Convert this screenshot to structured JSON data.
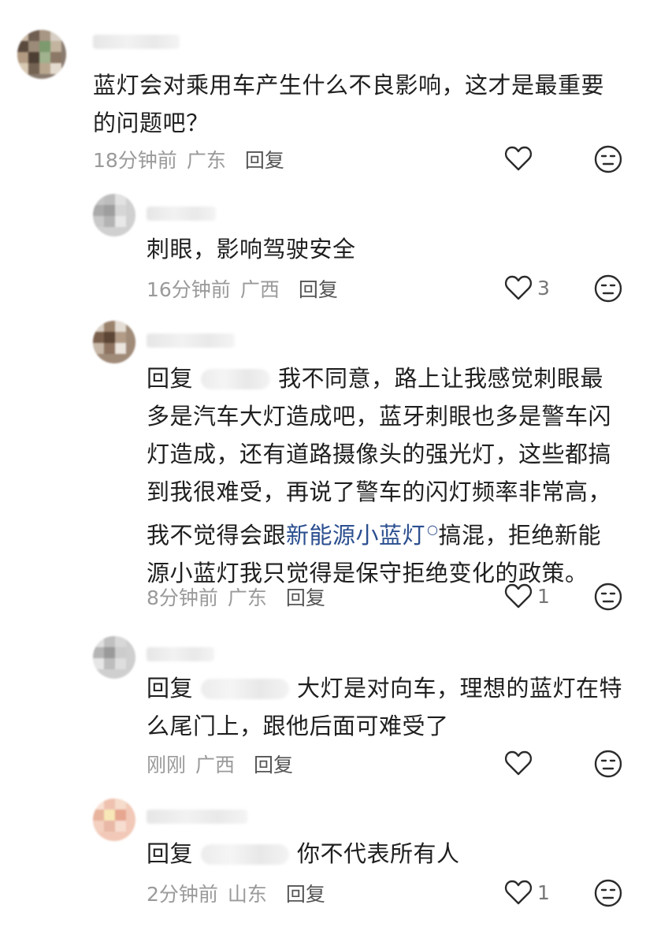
{
  "comments": [
    {
      "text": "蓝灯会对乘用车产生什么不良影响，这才是最重要的问题吧？",
      "time": "18分钟前",
      "region": "广东",
      "reply_label": "回复",
      "likes": ""
    },
    {
      "text": "刺眼，影响驾驶安全",
      "time": "16分钟前",
      "region": "广西",
      "reply_label": "回复",
      "likes": "3"
    },
    {
      "reply_prefix": "回复",
      "text_part1": "我不同意，路上让我感觉刺眼最多是汽车大灯造成吧，蓝牙刺眼也多是警车闪灯造成，还有道路摄像头的强光灯，这些都搞到我很难受，再说了警车的闪灯频率非常高，我不觉得会跟",
      "link_text": "新能源小蓝灯",
      "text_part2": "搞混，拒绝新能源小蓝灯我只觉得是保守拒绝变化的政策。",
      "time": "8分钟前",
      "region": "广东",
      "reply_label": "回复",
      "likes": "1"
    },
    {
      "reply_prefix": "回复",
      "text": "大灯是对向车，理想的蓝灯在特么尾门上，跟他后面可难受了",
      "time": "刚刚",
      "region": "广西",
      "reply_label": "回复",
      "likes": ""
    },
    {
      "reply_prefix": "回复",
      "text": "你不代表所有人",
      "time": "2分钟前",
      "region": "山东",
      "reply_label": "回复",
      "likes": "1"
    }
  ],
  "icons": {
    "like": "heart-outline-icon",
    "dislike": "unimpressed-face-icon",
    "search": "search-icon"
  },
  "colors": {
    "text": "#1f1f1f",
    "meta": "#9a9a9a",
    "link": "#2a4e8f",
    "icon": "#2b2b2b"
  }
}
